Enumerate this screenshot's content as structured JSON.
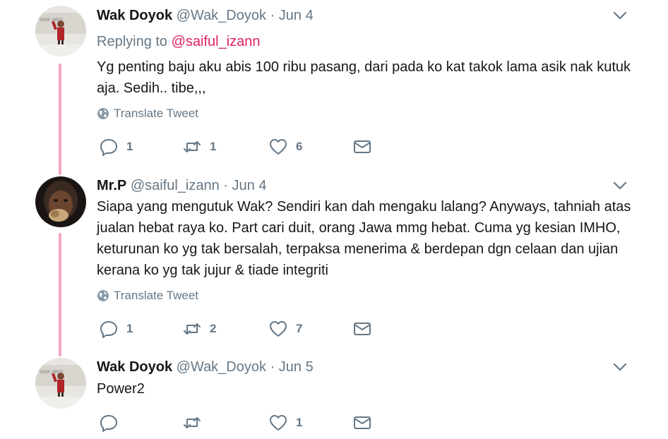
{
  "tweets": [
    {
      "name": "Wak Doyok",
      "handle": "@Wak_Doyok",
      "separator": "·",
      "date": "Jun 4",
      "replying_prefix": "Replying to",
      "replying_mention": "@saiful_izann",
      "text": "Yg penting baju aku abis 100 ribu pasang, dari pada ko kat takok lama asik nak kutuk aja. Sedih.. tibe,,,",
      "translate_label": "Translate Tweet",
      "reply_count": "1",
      "retweet_count": "1",
      "like_count": "6"
    },
    {
      "name": "Mr.P",
      "handle": "@saiful_izann",
      "separator": "·",
      "date": "Jun 4",
      "text": "Siapa yang mengutuk Wak? Sendiri kan dah mengaku lalang? Anyways, tahniah atas jualan hebat raya ko. Part cari duit, orang Jawa mmg hebat. Cuma yg kesian IMHO, keturunan ko yg tak bersalah, terpaksa menerima & berdepan dgn celaan dan ujian kerana ko yg tak jujur & tiade integriti",
      "translate_label": "Translate Tweet",
      "reply_count": "1",
      "retweet_count": "2",
      "like_count": "7"
    },
    {
      "name": "Wak Doyok",
      "handle": "@Wak_Doyok",
      "separator": "·",
      "date": "Jun 5",
      "text": "Power2",
      "reply_count": "",
      "retweet_count": "",
      "like_count": "1"
    }
  ],
  "colors": {
    "thread_line": "#f5a6c5",
    "mention": "#e0245e",
    "muted": "#657786"
  },
  "icons": [
    "reply-icon",
    "retweet-icon",
    "like-icon",
    "direct-message-icon",
    "globe-icon",
    "chevron-down-icon"
  ]
}
